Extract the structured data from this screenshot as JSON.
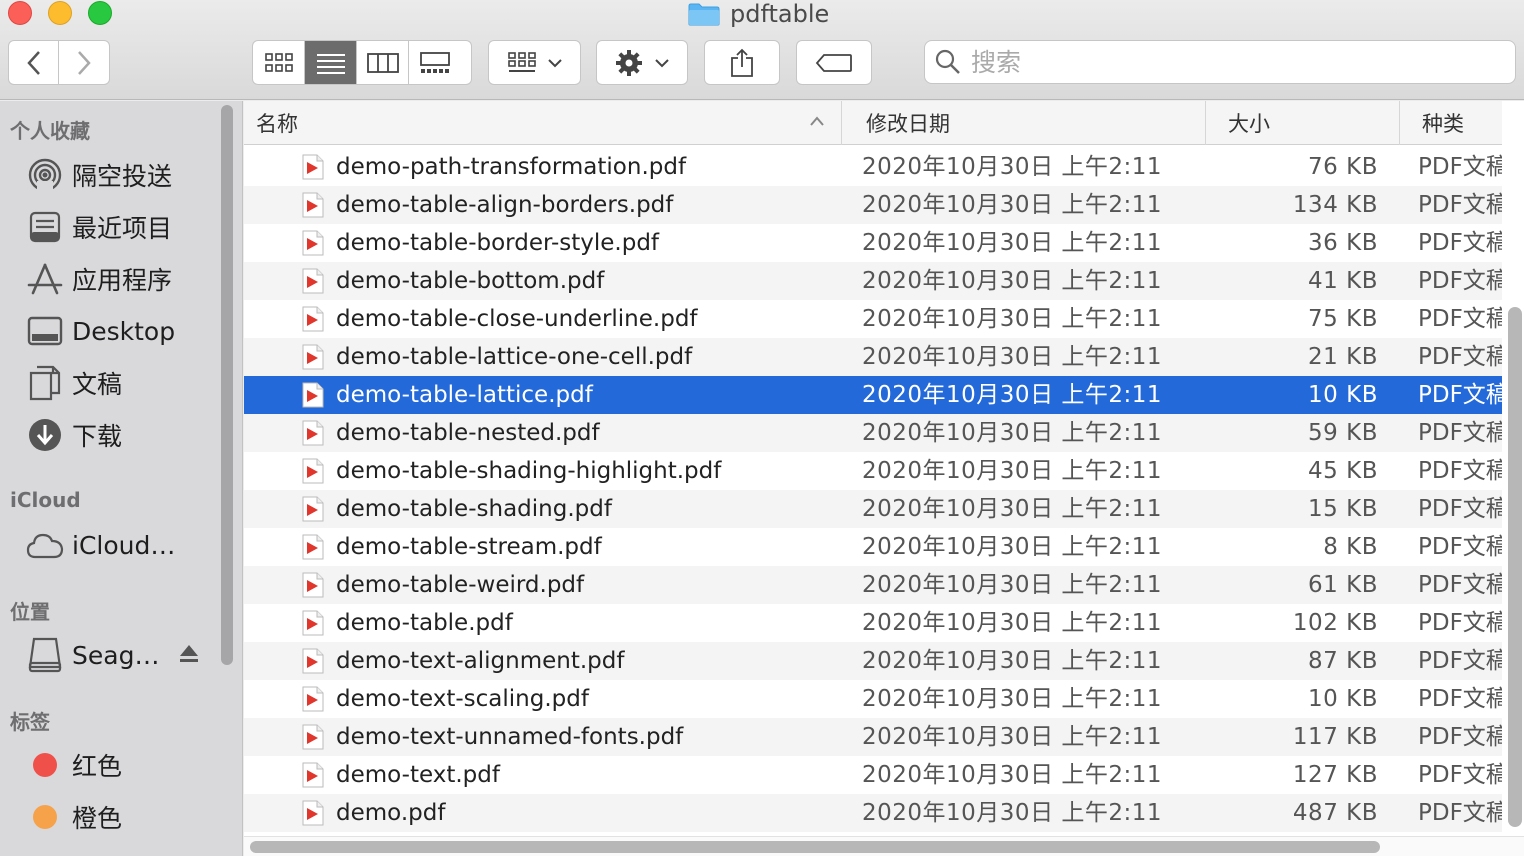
{
  "window": {
    "title": "pdftable"
  },
  "toolbar": {
    "back_icon": "chevron-left-icon",
    "forward_icon": "chevron-right-icon",
    "view_modes": [
      "icon-view",
      "list-view",
      "column-view",
      "gallery-view"
    ],
    "active_view": "list-view",
    "group_icon": "group-by-icon",
    "action_icon": "gear-icon",
    "share_icon": "share-icon",
    "tag_icon": "tag-icon"
  },
  "search": {
    "placeholder": "搜索",
    "value": ""
  },
  "sidebar": {
    "favorites_header": "个人收藏",
    "favorites": [
      {
        "label": "隔空投送",
        "icon": "airdrop-icon"
      },
      {
        "label": "最近项目",
        "icon": "recents-icon"
      },
      {
        "label": "应用程序",
        "icon": "applications-icon"
      },
      {
        "label": "Desktop",
        "icon": "desktop-icon"
      },
      {
        "label": "文稿",
        "icon": "documents-icon"
      },
      {
        "label": "下载",
        "icon": "downloads-icon"
      }
    ],
    "icloud_header": "iCloud",
    "icloud": [
      {
        "label": "iCloud…",
        "icon": "cloud-icon"
      }
    ],
    "locations_header": "位置",
    "locations": [
      {
        "label": "Seag…",
        "icon": "external-drive-icon",
        "eject_icon": "eject-icon"
      }
    ],
    "tags_header": "标签",
    "tags": [
      {
        "label": "红色",
        "color": "#f0504a"
      },
      {
        "label": "橙色",
        "color": "#f5a24a"
      }
    ]
  },
  "columns": {
    "name": "名称",
    "date": "修改日期",
    "size": "大小",
    "kind": "种类"
  },
  "files": [
    {
      "name": "demo-path-transformation.pdf",
      "date": "2020年10月30日 上午2:11",
      "size": "76 KB",
      "kind": "PDF文稿"
    },
    {
      "name": "demo-table-align-borders.pdf",
      "date": "2020年10月30日 上午2:11",
      "size": "134 KB",
      "kind": "PDF文稿"
    },
    {
      "name": "demo-table-border-style.pdf",
      "date": "2020年10月30日 上午2:11",
      "size": "36 KB",
      "kind": "PDF文稿"
    },
    {
      "name": "demo-table-bottom.pdf",
      "date": "2020年10月30日 上午2:11",
      "size": "41 KB",
      "kind": "PDF文稿"
    },
    {
      "name": "demo-table-close-underline.pdf",
      "date": "2020年10月30日 上午2:11",
      "size": "75 KB",
      "kind": "PDF文稿"
    },
    {
      "name": "demo-table-lattice-one-cell.pdf",
      "date": "2020年10月30日 上午2:11",
      "size": "21 KB",
      "kind": "PDF文稿"
    },
    {
      "name": "demo-table-lattice.pdf",
      "date": "2020年10月30日 上午2:11",
      "size": "10 KB",
      "kind": "PDF文稿",
      "selected": true
    },
    {
      "name": "demo-table-nested.pdf",
      "date": "2020年10月30日 上午2:11",
      "size": "59 KB",
      "kind": "PDF文稿"
    },
    {
      "name": "demo-table-shading-highlight.pdf",
      "date": "2020年10月30日 上午2:11",
      "size": "45 KB",
      "kind": "PDF文稿"
    },
    {
      "name": "demo-table-shading.pdf",
      "date": "2020年10月30日 上午2:11",
      "size": "15 KB",
      "kind": "PDF文稿"
    },
    {
      "name": "demo-table-stream.pdf",
      "date": "2020年10月30日 上午2:11",
      "size": "8 KB",
      "kind": "PDF文稿"
    },
    {
      "name": "demo-table-weird.pdf",
      "date": "2020年10月30日 上午2:11",
      "size": "61 KB",
      "kind": "PDF文稿"
    },
    {
      "name": "demo-table.pdf",
      "date": "2020年10月30日 上午2:11",
      "size": "102 KB",
      "kind": "PDF文稿"
    },
    {
      "name": "demo-text-alignment.pdf",
      "date": "2020年10月30日 上午2:11",
      "size": "87 KB",
      "kind": "PDF文稿"
    },
    {
      "name": "demo-text-scaling.pdf",
      "date": "2020年10月30日 上午2:11",
      "size": "10 KB",
      "kind": "PDF文稿"
    },
    {
      "name": "demo-text-unnamed-fonts.pdf",
      "date": "2020年10月30日 上午2:11",
      "size": "117 KB",
      "kind": "PDF文稿"
    },
    {
      "name": "demo-text.pdf",
      "date": "2020年10月30日 上午2:11",
      "size": "127 KB",
      "kind": "PDF文稿"
    },
    {
      "name": "demo.pdf",
      "date": "2020年10月30日 上午2:11",
      "size": "487 KB",
      "kind": "PDF文稿"
    }
  ],
  "colors": {
    "selection": "#2469d9",
    "accent_folder": "#5bb5f2",
    "pdf_icon": "#e0362c"
  }
}
